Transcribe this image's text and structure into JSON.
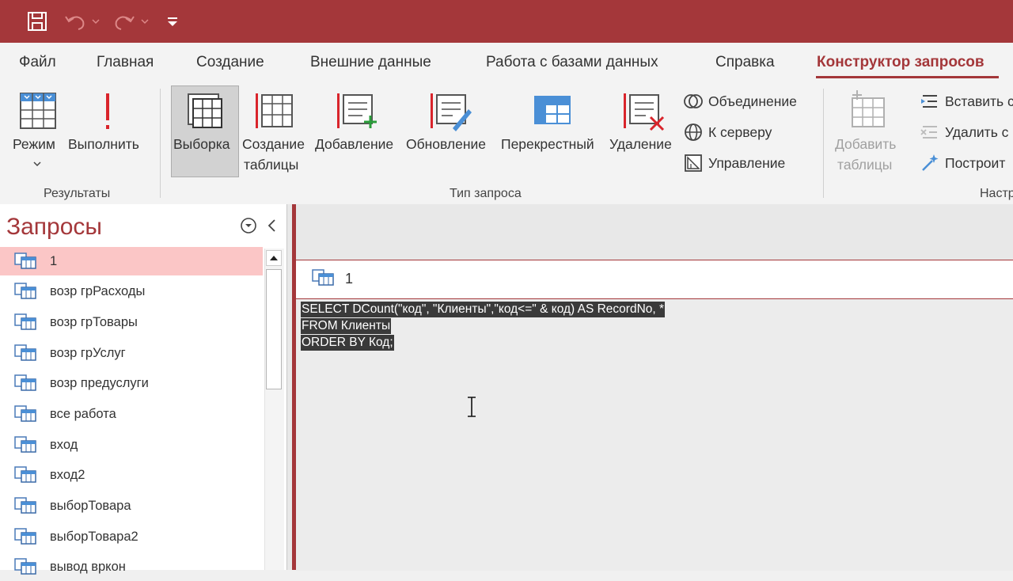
{
  "colors": {
    "accent": "#a4373a",
    "selection": "#fbc6c6"
  },
  "tabs": [
    {
      "label": "Файл"
    },
    {
      "label": "Главная"
    },
    {
      "label": "Создание"
    },
    {
      "label": "Внешние данные"
    },
    {
      "label": "Работа с базами данных"
    },
    {
      "label": "Справка"
    },
    {
      "label": "Конструктор запросов"
    }
  ],
  "ribbon": {
    "results": {
      "group_label": "Результаты",
      "mode_label": "Режим",
      "run_label": "Выполнить"
    },
    "query_type": {
      "group_label": "Тип запроса",
      "select_label": "Выборка",
      "make_table_line1": "Создание",
      "make_table_line2": "таблицы",
      "append_label": "Добавление",
      "update_label": "Обновление",
      "crosstab_label": "Перекрестный",
      "delete_label": "Удаление",
      "union_label": "Объединение",
      "passthrough_label": "К серверу",
      "ddl_label": "Управление"
    },
    "setup": {
      "group_label": "Настр",
      "add_tables_line1": "Добавить",
      "add_tables_line2": "таблицы",
      "insert_label": "Вставить с",
      "delete_label": "Удалить с",
      "builder_label": "Построит"
    }
  },
  "nav": {
    "title": "Запросы",
    "items": [
      {
        "label": "1"
      },
      {
        "label": "возр грРасходы"
      },
      {
        "label": "возр грТовары"
      },
      {
        "label": "возр грУслуг"
      },
      {
        "label": "возр предуслуги"
      },
      {
        "label": "все работа"
      },
      {
        "label": "вход"
      },
      {
        "label": "вход2"
      },
      {
        "label": "выборТовара"
      },
      {
        "label": "выборТовара2"
      },
      {
        "label": "вывод вркон"
      }
    ]
  },
  "document": {
    "tab_title": "1",
    "sql": [
      "SELECT DCount(\"код\", \"Клиенты\",\"код<=\" & код) AS RecordNo, *",
      "FROM Клиенты",
      "ORDER BY Код;"
    ]
  }
}
